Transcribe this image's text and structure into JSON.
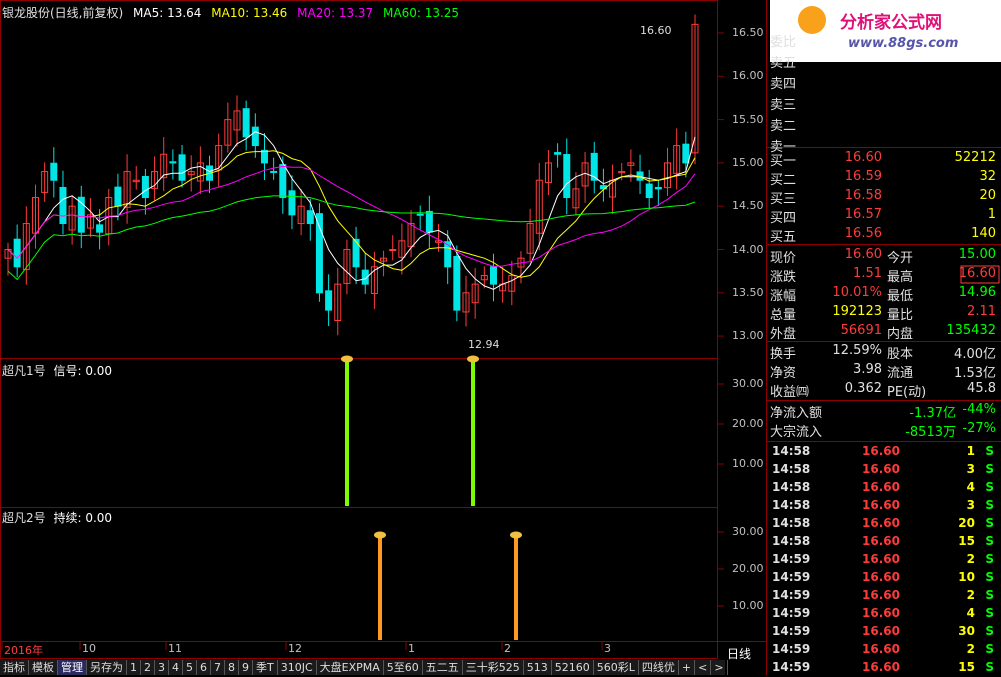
{
  "header": {
    "title": "银龙股份(日线,前复权)",
    "ma5": "MA5: 13.64",
    "ma10": "MA10: 13.46",
    "ma20": "MA20: 13.37",
    "ma60": "MA60: 13.25"
  },
  "price_ticks": [
    "16.50",
    "16.00",
    "15.50",
    "15.00",
    "14.50",
    "14.00",
    "13.50",
    "13.00"
  ],
  "annotations": {
    "high": "16.60",
    "low": "12.94"
  },
  "panel1": {
    "title": "超凡1号",
    "signal": "信号: 0.00",
    "ticks": [
      "30.00",
      "20.00",
      "10.00"
    ]
  },
  "panel2": {
    "title": "超凡2号",
    "signal": "持续: 0.00",
    "ticks": [
      "30.00",
      "20.00",
      "10.00"
    ]
  },
  "dates": [
    "2016年",
    "10",
    "11",
    "12",
    "1",
    "2",
    "3"
  ],
  "period": "日线",
  "toolbar": [
    "指标",
    "模板",
    "管理",
    "另存为",
    "1",
    "2",
    "3",
    "4",
    "5",
    "6",
    "7",
    "8",
    "9",
    "季T",
    "310JC",
    "大盘EXPMA",
    "5至60",
    "五二五",
    "三十彩525",
    "513",
    "52160",
    "560彩L",
    "四线优",
    "+",
    "<",
    ">"
  ],
  "logo": {
    "title": "分析家公式网",
    "url": "www.88gs.com"
  },
  "order_book": {
    "weibi_label": "委比",
    "sell": [
      {
        "label": "卖五"
      },
      {
        "label": "卖四"
      },
      {
        "label": "卖三"
      },
      {
        "label": "卖二"
      },
      {
        "label": "卖一"
      }
    ],
    "buy": [
      {
        "label": "买一",
        "price": "16.60",
        "vol": "52212"
      },
      {
        "label": "买二",
        "price": "16.59",
        "vol": "32"
      },
      {
        "label": "买三",
        "price": "16.58",
        "vol": "20"
      },
      {
        "label": "买四",
        "price": "16.57",
        "vol": "1"
      },
      {
        "label": "买五",
        "price": "16.56",
        "vol": "140"
      }
    ]
  },
  "quote": [
    {
      "l1": "现价",
      "v1": "16.60",
      "l2": "今开",
      "v2": "15.00"
    },
    {
      "l1": "涨跌",
      "v1": "1.51",
      "l2": "最高",
      "v2": "16.60"
    },
    {
      "l1": "涨幅",
      "v1": "10.01%",
      "l2": "最低",
      "v2": "14.96"
    },
    {
      "l1": "总量",
      "v1": "192123",
      "l2": "量比",
      "v2": "2.11"
    },
    {
      "l1": "外盘",
      "v1": "56691",
      "l2": "内盘",
      "v2": "135432"
    }
  ],
  "fundamentals": [
    {
      "l1": "换手",
      "v1": "12.59%",
      "l2": "股本",
      "v2": "4.00亿"
    },
    {
      "l1": "净资",
      "v1": "3.98",
      "l2": "流通",
      "v2": "1.53亿"
    },
    {
      "l1": "收益㈣",
      "v1": "0.362",
      "l2": "PE(动)",
      "v2": "45.8"
    }
  ],
  "flows": [
    {
      "label": "净流入额",
      "value": "-1.37亿",
      "pct": "-44%"
    },
    {
      "label": "大宗流入",
      "value": "-8513万",
      "pct": "-27%"
    }
  ],
  "ticks_list": [
    {
      "time": "14:58",
      "price": "16.60",
      "vol": "1",
      "side": "S"
    },
    {
      "time": "14:58",
      "price": "16.60",
      "vol": "3",
      "side": "S"
    },
    {
      "time": "14:58",
      "price": "16.60",
      "vol": "4",
      "side": "S"
    },
    {
      "time": "14:58",
      "price": "16.60",
      "vol": "3",
      "side": "S"
    },
    {
      "time": "14:58",
      "price": "16.60",
      "vol": "20",
      "side": "S"
    },
    {
      "time": "14:58",
      "price": "16.60",
      "vol": "15",
      "side": "S"
    },
    {
      "time": "14:59",
      "price": "16.60",
      "vol": "2",
      "side": "S"
    },
    {
      "time": "14:59",
      "price": "16.60",
      "vol": "10",
      "side": "S"
    },
    {
      "time": "14:59",
      "price": "16.60",
      "vol": "2",
      "side": "S"
    },
    {
      "time": "14:59",
      "price": "16.60",
      "vol": "4",
      "side": "S"
    },
    {
      "time": "14:59",
      "price": "16.60",
      "vol": "30",
      "side": "S"
    },
    {
      "time": "14:59",
      "price": "16.60",
      "vol": "2",
      "side": "S"
    },
    {
      "time": "14:59",
      "price": "16.60",
      "vol": "15",
      "side": "S"
    }
  ],
  "colors": {
    "up": "#ff3b3b",
    "down": "#00e5e5",
    "ma5": "#ffffff",
    "ma10": "#ffff00",
    "ma20": "#ff00ff",
    "ma60": "#00ff00",
    "grid": "#8b0000",
    "signal1": "#7cfc00",
    "signal2": "#ff9a20"
  }
}
